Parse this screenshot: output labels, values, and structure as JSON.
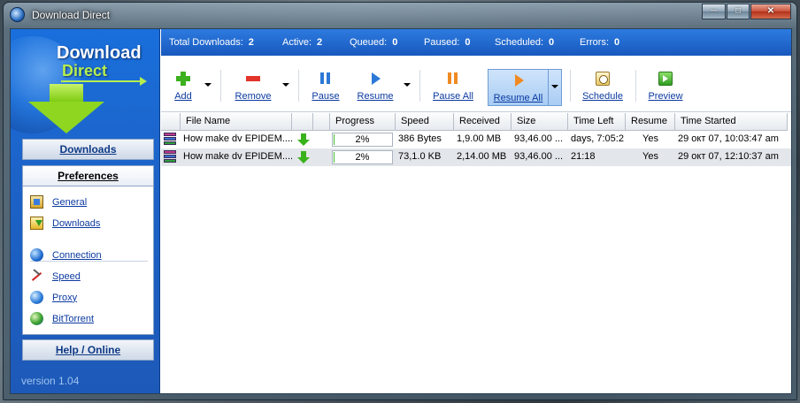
{
  "window": {
    "title": "Download Direct"
  },
  "logo": {
    "line1": "Download",
    "line2": "Direct"
  },
  "sidebar": {
    "downloads_label": "Downloads",
    "preferences_label": "Preferences",
    "items": [
      {
        "label": "General",
        "icon": "settings-icon"
      },
      {
        "label": "Downloads",
        "icon": "download-folder-icon"
      },
      {
        "label": "Connection",
        "icon": "globe-icon"
      },
      {
        "label": "Speed",
        "icon": "speed-icon"
      },
      {
        "label": "Proxy",
        "icon": "proxy-globe-icon"
      },
      {
        "label": "BitTorrent",
        "icon": "bittorrent-icon"
      }
    ],
    "help_label": "Help / Online",
    "version": "version 1.04"
  },
  "stats": {
    "total_label": "Total Downloads:",
    "total": "2",
    "active_label": "Active:",
    "active": "2",
    "queued_label": "Queued:",
    "queued": "0",
    "paused_label": "Paused:",
    "paused": "0",
    "scheduled_label": "Scheduled:",
    "scheduled": "0",
    "errors_label": "Errors:",
    "errors": "0"
  },
  "toolbar": {
    "add": "Add",
    "remove": "Remove",
    "pause": "Pause",
    "resume": "Resume",
    "pause_all": "Pause All",
    "resume_all": "Resume All",
    "schedule": "Schedule",
    "preview": "Preview"
  },
  "table": {
    "columns": [
      "File Name",
      "Progress",
      "Speed",
      "Received",
      "Size",
      "Time Left",
      "Resume",
      "Time Started"
    ],
    "rows": [
      {
        "file": "How make dv EPIDEM....",
        "progress": "2%",
        "progress_fraction": 0.02,
        "speed": "386 Bytes",
        "received": "1,9.00 MB",
        "size": "93,46.00 ...",
        "time_left": "days, 7:05:2",
        "resume": "Yes",
        "started": "29 окт 07, 10:03:47 am"
      },
      {
        "file": "How make dv EPIDEM....",
        "progress": "2%",
        "progress_fraction": 0.02,
        "speed": "73,1.0 KB",
        "received": "2,14.00 MB",
        "size": "93,46.00 ...",
        "time_left": "21:18",
        "resume": "Yes",
        "started": "29 окт 07, 12:10:37 am"
      }
    ]
  }
}
